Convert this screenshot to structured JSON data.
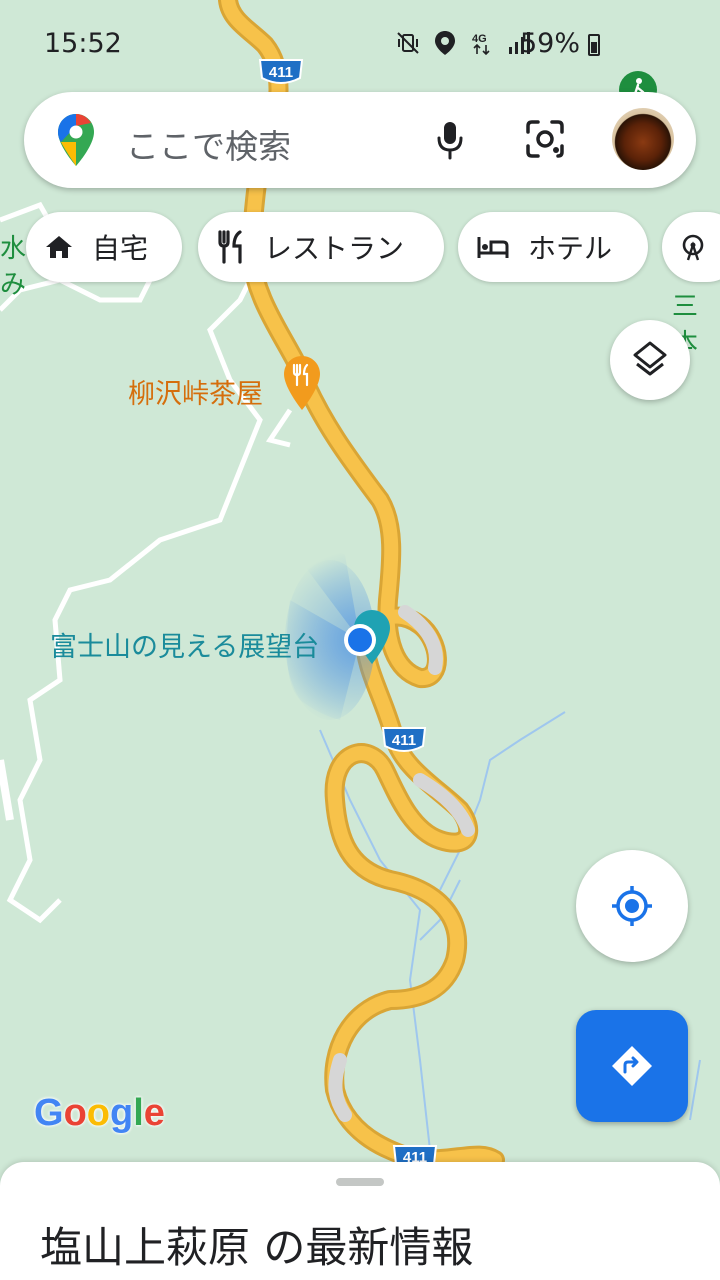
{
  "status_bar": {
    "time": "15:52",
    "battery": "59%",
    "icons": [
      "vibrate-off-icon",
      "location-icon",
      "4g-icon",
      "signal-icon",
      "battery-icon"
    ]
  },
  "search": {
    "placeholder": "ここで検索"
  },
  "chips": [
    {
      "label": "自宅",
      "icon": "home-icon"
    },
    {
      "label": "レストラン",
      "icon": "restaurant-icon"
    },
    {
      "label": "ホテル",
      "icon": "hotel-icon"
    }
  ],
  "map": {
    "road_shield": "411",
    "poi_restaurant": "柳沢峠茶屋",
    "poi_viewpoint": "富士山の見える展望台",
    "partial_labels": [
      "水",
      "み",
      "三本"
    ]
  },
  "google_logo": "Google",
  "bottom_sheet": {
    "title": "塩山上萩原 の最新情報"
  },
  "colors": {
    "map_bg": "#cfe8d6",
    "road": "#f7c24a",
    "accent_blue": "#1a73e8",
    "poi_orange": "#d56e0c",
    "poi_teal": "#1a8b9b"
  }
}
